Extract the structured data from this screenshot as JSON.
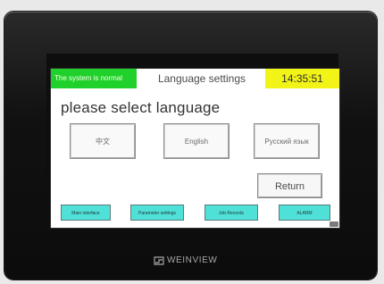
{
  "header": {
    "status": "The system is normal",
    "title": "Language settings",
    "time": "14:35:51"
  },
  "main": {
    "prompt": "please select language",
    "languages": {
      "chinese": "中文",
      "english": "English",
      "russian": "Русский язык"
    },
    "return_label": "Return"
  },
  "nav": {
    "main_interface": "Main interface",
    "parameter_settings": "Parameter settings",
    "job_records": "Job Records",
    "alarm": "ALARM"
  },
  "branding": {
    "name": "WEINVIEW"
  },
  "colors": {
    "status_green": "#21d12b",
    "time_yellow": "#f2f316",
    "nav_cyan": "#4fe1d8"
  }
}
